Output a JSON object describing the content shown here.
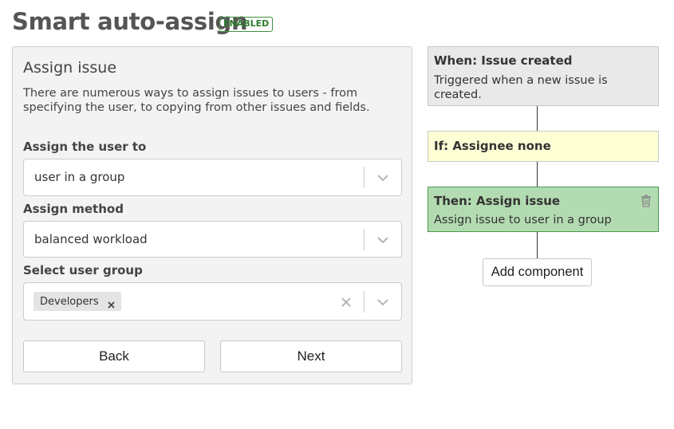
{
  "header": {
    "title": "Smart auto-assign",
    "status_badge": "ENABLED",
    "badge_color": "#2d7a2d"
  },
  "form": {
    "title": "Assign issue",
    "description": "There are numerous ways to assign issues to users - from specifying the user, to copying from other issues and fields.",
    "fields": [
      {
        "label": "Assign the user to",
        "value": "user in a group"
      },
      {
        "label": "Assign method",
        "value": "balanced workload"
      },
      {
        "label": "Select user group",
        "chips": [
          "Developers"
        ]
      }
    ],
    "back_label": "Back",
    "next_label": "Next"
  },
  "flow": {
    "trigger": {
      "title": "When: Issue created",
      "description": "Triggered when a new issue is created.",
      "color": "#e9e9e9"
    },
    "condition": {
      "title": "If: Assignee none",
      "color": "#ffffd6"
    },
    "action": {
      "title": "Then: Assign issue",
      "description": "Assign issue to user in a group",
      "color": "#b3dbb1",
      "border_color": "#4a9a4a"
    },
    "add_component_label": "Add component"
  }
}
